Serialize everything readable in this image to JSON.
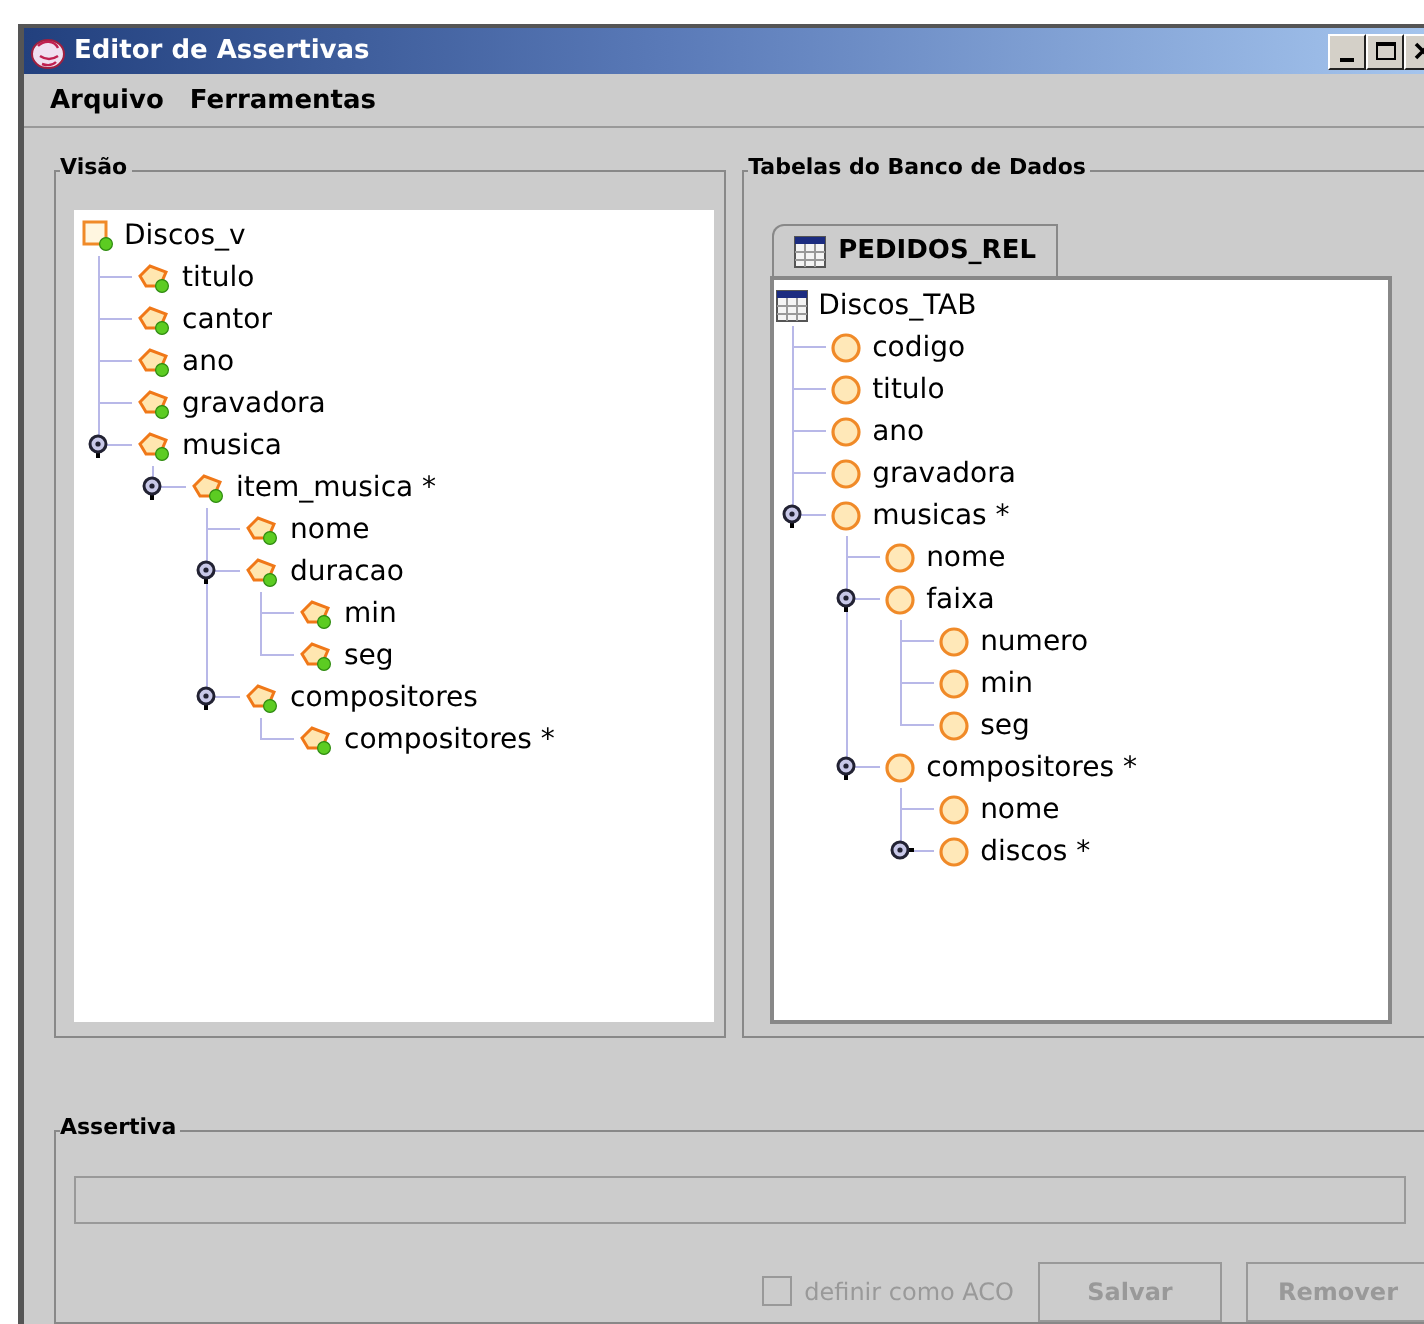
{
  "window": {
    "title": "Editor de Assertivas"
  },
  "menu": [
    "Arquivo",
    "Ferramentas"
  ],
  "view_panel": {
    "title": "Visão",
    "tree": {
      "label": "Discos_v",
      "kind": "root",
      "children": [
        {
          "label": "titulo",
          "kind": "element"
        },
        {
          "label": "cantor",
          "kind": "element"
        },
        {
          "label": "ano",
          "kind": "element"
        },
        {
          "label": "gravadora",
          "kind": "element"
        },
        {
          "label": "musica",
          "kind": "element",
          "expanded": true,
          "children": [
            {
              "label": "item_musica *",
              "kind": "element",
              "expanded": true,
              "children": [
                {
                  "label": "nome",
                  "kind": "element"
                },
                {
                  "label": "duracao",
                  "kind": "element",
                  "expanded": true,
                  "children": [
                    {
                      "label": "min",
                      "kind": "element"
                    },
                    {
                      "label": "seg",
                      "kind": "element"
                    }
                  ]
                },
                {
                  "label": "compositores",
                  "kind": "element",
                  "expanded": true,
                  "children": [
                    {
                      "label": "compositores *",
                      "kind": "element"
                    }
                  ]
                }
              ]
            }
          ]
        }
      ]
    }
  },
  "tables_panel": {
    "title": "Tabelas do Banco de Dados",
    "tabs": [
      {
        "label": "PEDIDOS_REL",
        "selected": true
      }
    ],
    "tree": {
      "label": "Discos_TAB",
      "kind": "table",
      "children": [
        {
          "label": "codigo",
          "kind": "column"
        },
        {
          "label": "titulo",
          "kind": "column"
        },
        {
          "label": "ano",
          "kind": "column"
        },
        {
          "label": "gravadora",
          "kind": "column"
        },
        {
          "label": "musicas *",
          "kind": "column",
          "expanded": true,
          "children": [
            {
              "label": "nome",
              "kind": "column"
            },
            {
              "label": "faixa",
              "kind": "column",
              "expanded": true,
              "children": [
                {
                  "label": "numero",
                  "kind": "column"
                },
                {
                  "label": "min",
                  "kind": "column"
                },
                {
                  "label": "seg",
                  "kind": "column"
                }
              ]
            },
            {
              "label": "compositores *",
              "kind": "column",
              "expanded": true,
              "children": [
                {
                  "label": "nome",
                  "kind": "column"
                },
                {
                  "label": "discos *",
                  "kind": "column",
                  "expanded": false
                }
              ]
            }
          ]
        }
      ]
    }
  },
  "assertion_panel": {
    "title": "Assertiva",
    "field": {
      "disabled": true
    },
    "checkbox": {
      "label": "definir como ACO",
      "checked": false,
      "disabled": true
    },
    "buttons": [
      {
        "label": "Salvar",
        "disabled": true
      },
      {
        "label": "Remover",
        "disabled": true
      }
    ]
  }
}
